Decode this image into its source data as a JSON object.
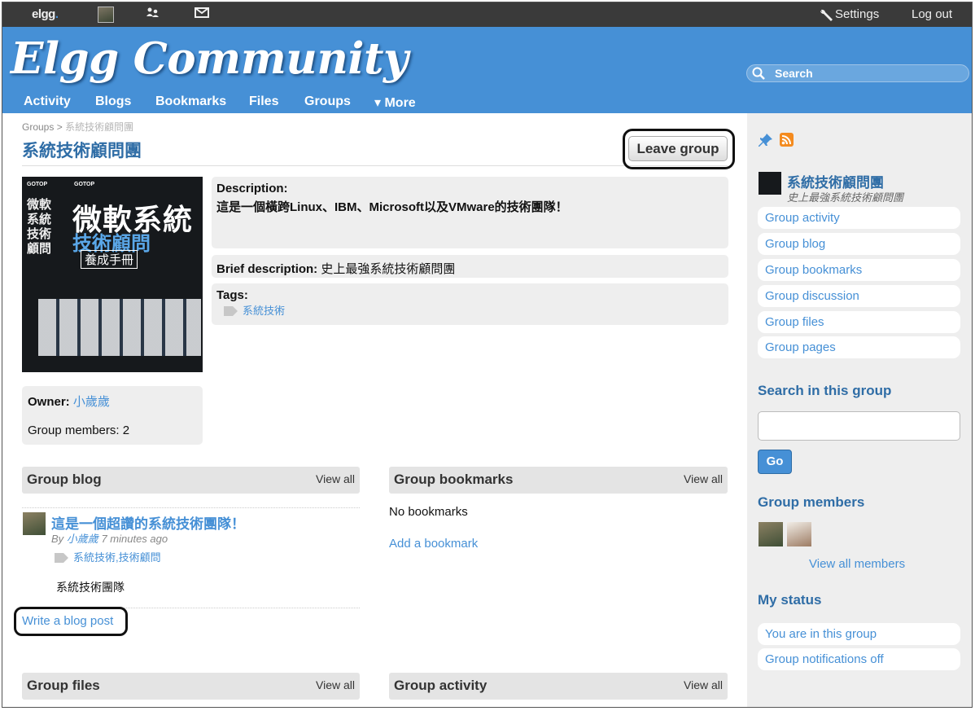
{
  "topbar": {
    "logo": "elgg",
    "avatar_icon": "user-avatar",
    "friends_icon": "friends-icon",
    "messages_icon": "envelope-icon",
    "settings": "Settings",
    "logout": "Log out"
  },
  "header": {
    "site_title": "Elgg Community",
    "nav": [
      "Activity",
      "Blogs",
      "Bookmarks",
      "Files",
      "Groups",
      "▾ More"
    ],
    "search_placeholder": "Search"
  },
  "breadcrumb": {
    "root": "Groups",
    "separator": ">",
    "current": "系統技術顧問團"
  },
  "group": {
    "title": "系統技術顧問團",
    "leave_button": "Leave group",
    "description_label": "Description:",
    "description": "這是一個橫跨Linux、IBM、Microsoft以及VMware的技術團隊！",
    "brief_label": "Brief description:",
    "brief": "史上最強系統技術顧問團",
    "tags_label": "Tags:",
    "tag": "系統技術",
    "owner_label": "Owner:",
    "owner": "小歲歲",
    "members_text": "Group members: 2"
  },
  "cover": {
    "publisher": "GOTOP",
    "title_line1": "微軟系統",
    "title_line2": "技術顧問",
    "title_line3": "養成手冊",
    "spine": "微軟系統技術顧問"
  },
  "modules": {
    "blog": {
      "title": "Group blog",
      "view_all": "View all"
    },
    "bookmarks": {
      "title": "Group bookmarks",
      "view_all": "View all",
      "empty": "No bookmarks",
      "add": "Add a bookmark"
    },
    "files": {
      "title": "Group files",
      "view_all": "View all"
    },
    "activity": {
      "title": "Group activity",
      "view_all": "View all"
    }
  },
  "blog_post": {
    "title": "這是一個超讚的系統技術團隊！",
    "by": "By",
    "author": "小歲歲",
    "time": "7 minutes ago",
    "tags": "系統技術,技術顧問",
    "excerpt": "系統技術團隊",
    "write_link": "Write a blog post"
  },
  "sidebar": {
    "group_name": "系統技術顧問團",
    "group_brief": "史上最強系統技術顧問團",
    "menu": [
      "Group activity",
      "Group blog",
      "Group bookmarks",
      "Group discussion",
      "Group files",
      "Group pages"
    ],
    "search_heading": "Search in this group",
    "go_button": "Go",
    "members_heading": "Group members",
    "view_all_members": "View all members",
    "status_heading": "My status",
    "status_items": [
      "You are in this group",
      "Group notifications off"
    ]
  },
  "colors": {
    "accent": "#4690d6",
    "topbar": "#3a3a3a",
    "title": "#2f6da6"
  }
}
